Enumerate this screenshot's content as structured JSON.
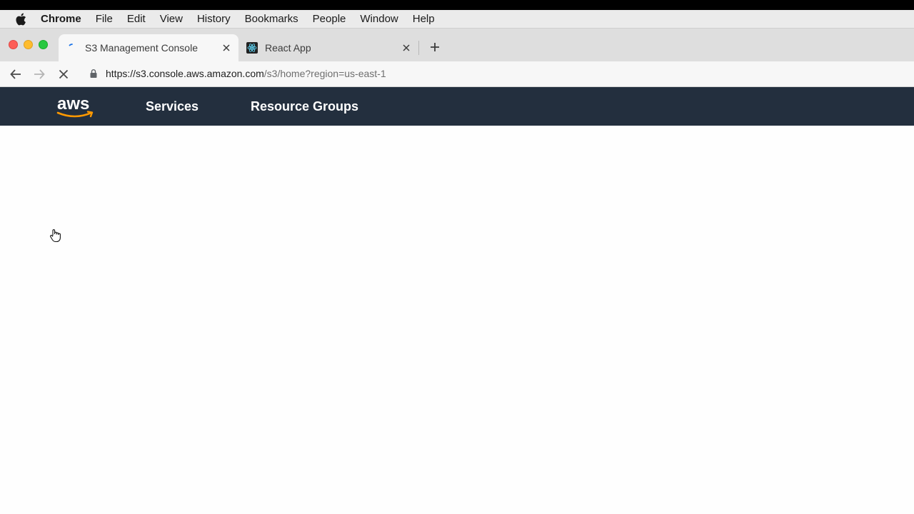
{
  "menubar": {
    "app_name": "Chrome",
    "items": [
      "File",
      "Edit",
      "View",
      "History",
      "Bookmarks",
      "People",
      "Window",
      "Help"
    ]
  },
  "tabs": [
    {
      "title": "S3 Management Console",
      "active": true,
      "icon": "loading-spinner-icon"
    },
    {
      "title": "React App",
      "active": false,
      "icon": "react-favicon-icon"
    }
  ],
  "toolbar": {
    "url_host": "https://s3.console.aws.amazon.com",
    "url_path": "/s3/home?region=us-east-1"
  },
  "aws_nav": {
    "logo_text": "aws",
    "services": "Services",
    "resource_groups": "Resource Groups"
  },
  "colors": {
    "aws_nav_bg": "#232f3e",
    "aws_orange": "#ff9900"
  }
}
